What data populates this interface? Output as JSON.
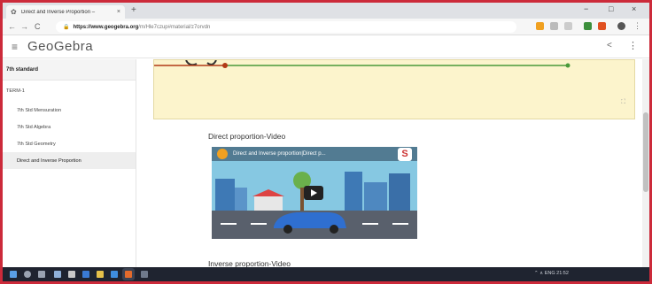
{
  "browser": {
    "tab_title": "Direct and Inverse Proportion – ",
    "tab_close": "×",
    "new_tab": "+",
    "controls": {
      "minimize": "−",
      "maximize": "□",
      "close": "×"
    },
    "nav": {
      "back": "←",
      "forward": "→",
      "reload": "C"
    },
    "url_host": "https://www.geogebra.org",
    "url_path": "/m/Hle7czup#material/z7orvdn"
  },
  "header": {
    "menu_icon": "≡",
    "brand": "GeoGebra",
    "share_icon": "<",
    "more_icon": "⋮"
  },
  "sidebar": {
    "heading": "7th standard",
    "section": "TERM-1",
    "items": [
      {
        "label": "7th Std Mensuration"
      },
      {
        "label": "7th Std Algebra"
      },
      {
        "label": "7th Std Geometry"
      },
      {
        "label": "Direct and Inverse Proportion"
      }
    ]
  },
  "main": {
    "fullscreen_icon": "⛶",
    "video1_title": "Direct proportion-Video",
    "video1_overlay": "Direct and Inverse proportion|Direct p...",
    "video1_logo": "S",
    "video2_title": "Inverse proportion-Video"
  },
  "taskbar": {
    "tray_text": "⌃  ∧  ENG  21:52"
  },
  "colors": {
    "frame": "#cc2a3a",
    "applet_bg": "#fcf4cc",
    "line_red": "#b23a16",
    "line_green": "#4a9a3a"
  }
}
